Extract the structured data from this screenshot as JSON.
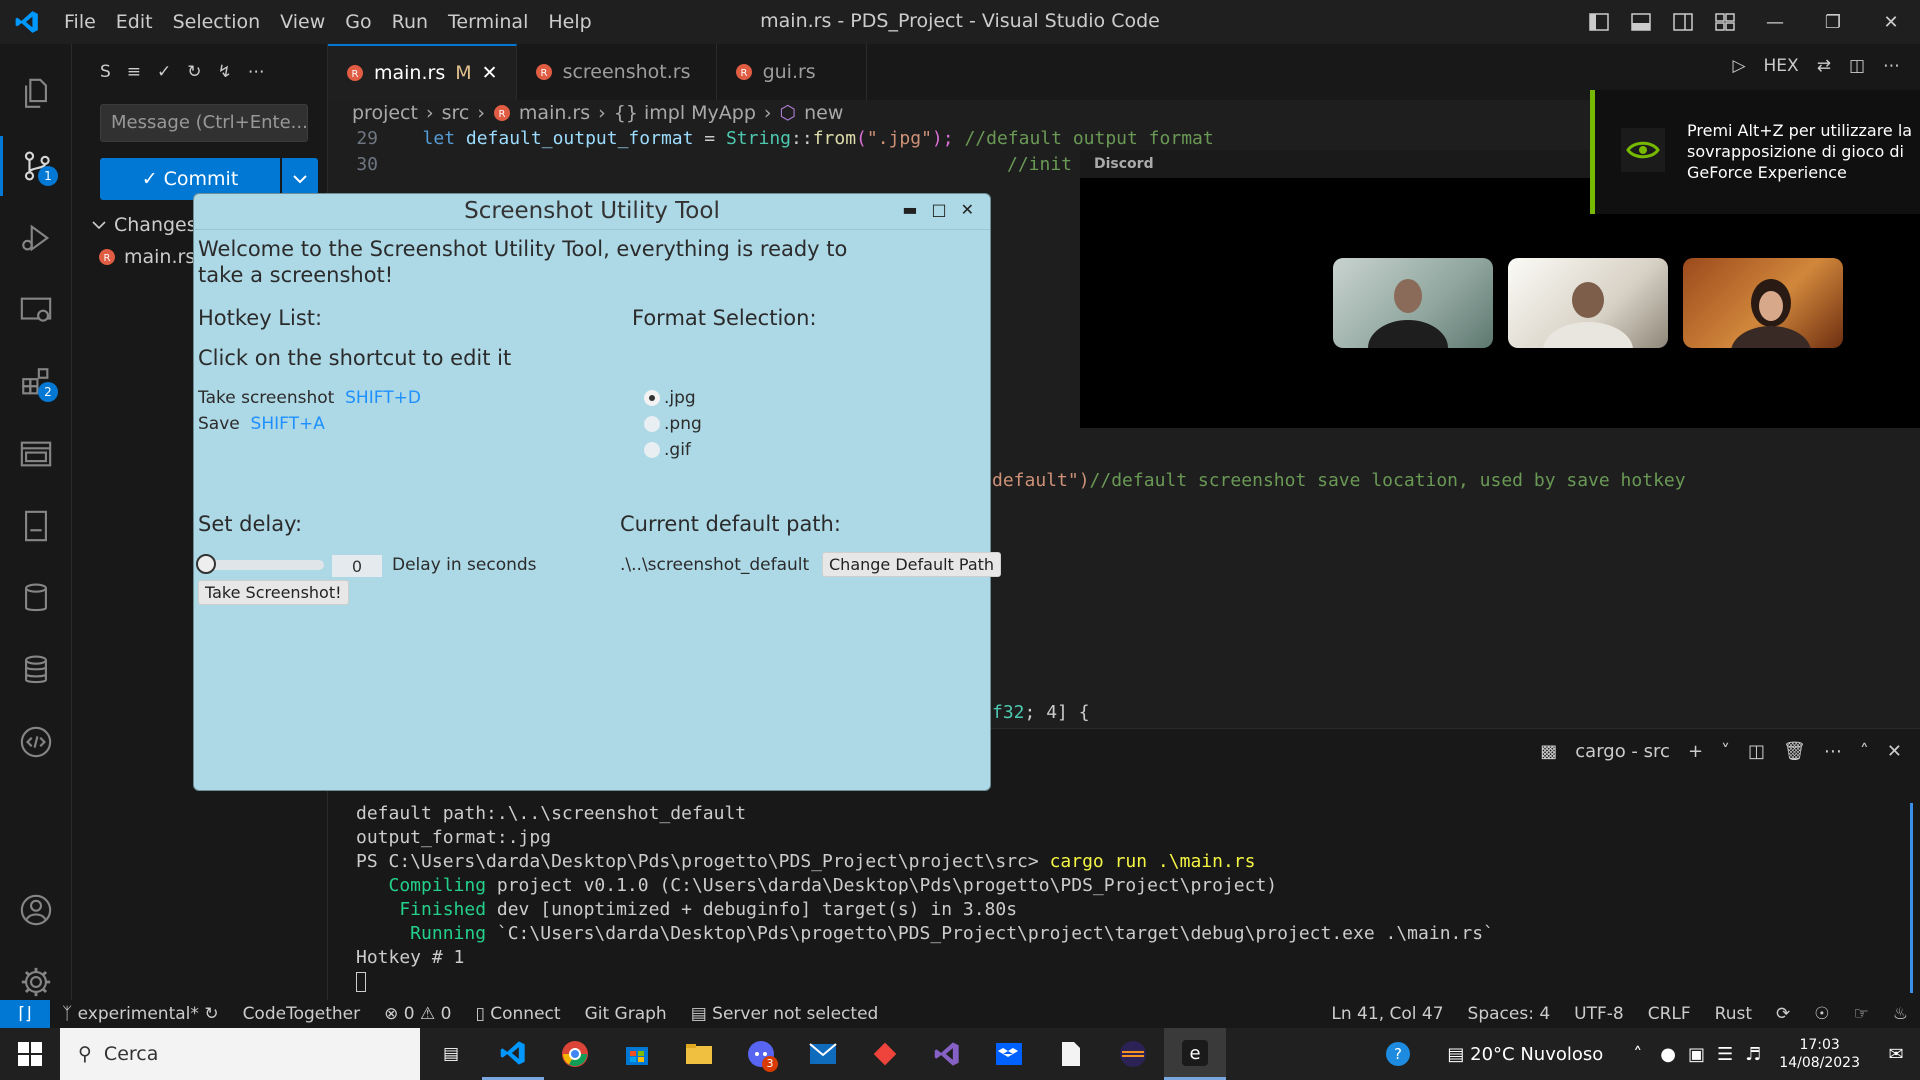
{
  "titlebar": {
    "menu": [
      "File",
      "Edit",
      "Selection",
      "View",
      "Go",
      "Run",
      "Terminal",
      "Help"
    ],
    "title": "main.rs - PDS_Project - Visual Studio Code"
  },
  "activity": {
    "scm_badge": "1",
    "ext_badge": "2"
  },
  "sidebar": {
    "header_letter": "S",
    "commit_placeholder": "Message (Ctrl+Ente...",
    "commit_label": "✓ Commit",
    "changes_label": "Changes",
    "changed_file": "main.rs"
  },
  "tabs": [
    {
      "label": "main.rs",
      "modified": "M"
    },
    {
      "label": "screenshot.rs"
    },
    {
      "label": "gui.rs"
    }
  ],
  "editor_actions": {
    "hex": "HEX"
  },
  "breadcrumb": [
    "project",
    "src",
    "main.rs",
    "{} impl MyApp",
    "new"
  ],
  "code": {
    "lines": [
      {
        "num": "29"
      },
      {
        "num": "30"
      }
    ],
    "l29_kw": "let",
    "l29_var": "default_output_format",
    "l29_op": " = ",
    "l29_ty": "String",
    "l29_sep": "::",
    "l29_fn": "from",
    "l29_open": "(",
    "l29_str": "\".jpg\"",
    "l29_close": ");",
    "l29_comment": "//default output format",
    "l30_comment": "//init",
    "l_default_str": "default\")",
    "l_default_comment": "//default screenshot save location, used by save hotkey",
    "l_f32_num": "f32",
    "l_f32_rest": "; 4] {"
  },
  "panel": {
    "terminal_name": "cargo - src",
    "lines": [
      "default path:.\\..\\screenshot_default",
      "output_format:.jpg"
    ],
    "prompt": "PS C:\\Users\\darda\\Desktop\\Pds\\progetto\\PDS_Project\\project\\src> ",
    "command": "cargo run .\\main.rs",
    "compiling_label": "   Compiling",
    "compiling_text": " project v0.1.0 (C:\\Users\\darda\\Desktop\\Pds\\progetto\\PDS_Project\\project)",
    "finished_label": "    Finished",
    "finished_text": " dev [unoptimized + debuginfo] target(s) in 3.80s",
    "running_label": "     Running",
    "running_text": " `C:\\Users\\darda\\Desktop\\Pds\\progetto\\PDS_Project\\project\\target\\debug\\project.exe .\\main.rs`",
    "hotkey_line": "Hotkey # 1"
  },
  "statusbar": {
    "branch": "experimental*",
    "codetogether": "CodeTogether",
    "errors": "0",
    "warnings": "0",
    "connect": "Connect",
    "git_graph": "Git Graph",
    "server": "Server not selected",
    "position": "Ln 41, Col 47",
    "spaces": "Spaces: 4",
    "encoding": "UTF-8",
    "eol": "CRLF",
    "language": "Rust"
  },
  "taskbar": {
    "search": "Cerca",
    "weather": "20°C  Nuvoloso",
    "time": "17:03",
    "date": "14/08/2023",
    "discord_badge": "3"
  },
  "app": {
    "title": "Screenshot Utility Tool",
    "welcome": "Welcome to the Screenshot Utility Tool, everything is ready to take a screenshot!",
    "hotkey_heading": "Hotkey List:",
    "hotkey_hint": "Click on the shortcut to edit it",
    "hotkeys": [
      {
        "label": "Take screenshot",
        "shortcut": "SHIFT+D"
      },
      {
        "label": "Save",
        "shortcut": "SHIFT+A"
      }
    ],
    "format_heading": "Format Selection:",
    "formats": [
      ".jpg",
      ".png",
      ".gif"
    ],
    "selected_format": ".jpg",
    "delay_heading": "Set delay:",
    "delay_value": "0",
    "delay_label": "Delay in seconds",
    "take_button": "Take Screenshot!",
    "path_heading": "Current default path:",
    "path_value": ".\\..\\screenshot_default",
    "change_path_button": "Change Default Path"
  },
  "discord": {
    "label": "Discord"
  },
  "nvidia": {
    "text": "Premi Alt+Z per utilizzare la sovrapposizione di gioco di GeForce Experience"
  },
  "colors": {
    "accent": "#0078d4",
    "app_bg": "#add8e6",
    "nvidia_green": "#76b900"
  }
}
